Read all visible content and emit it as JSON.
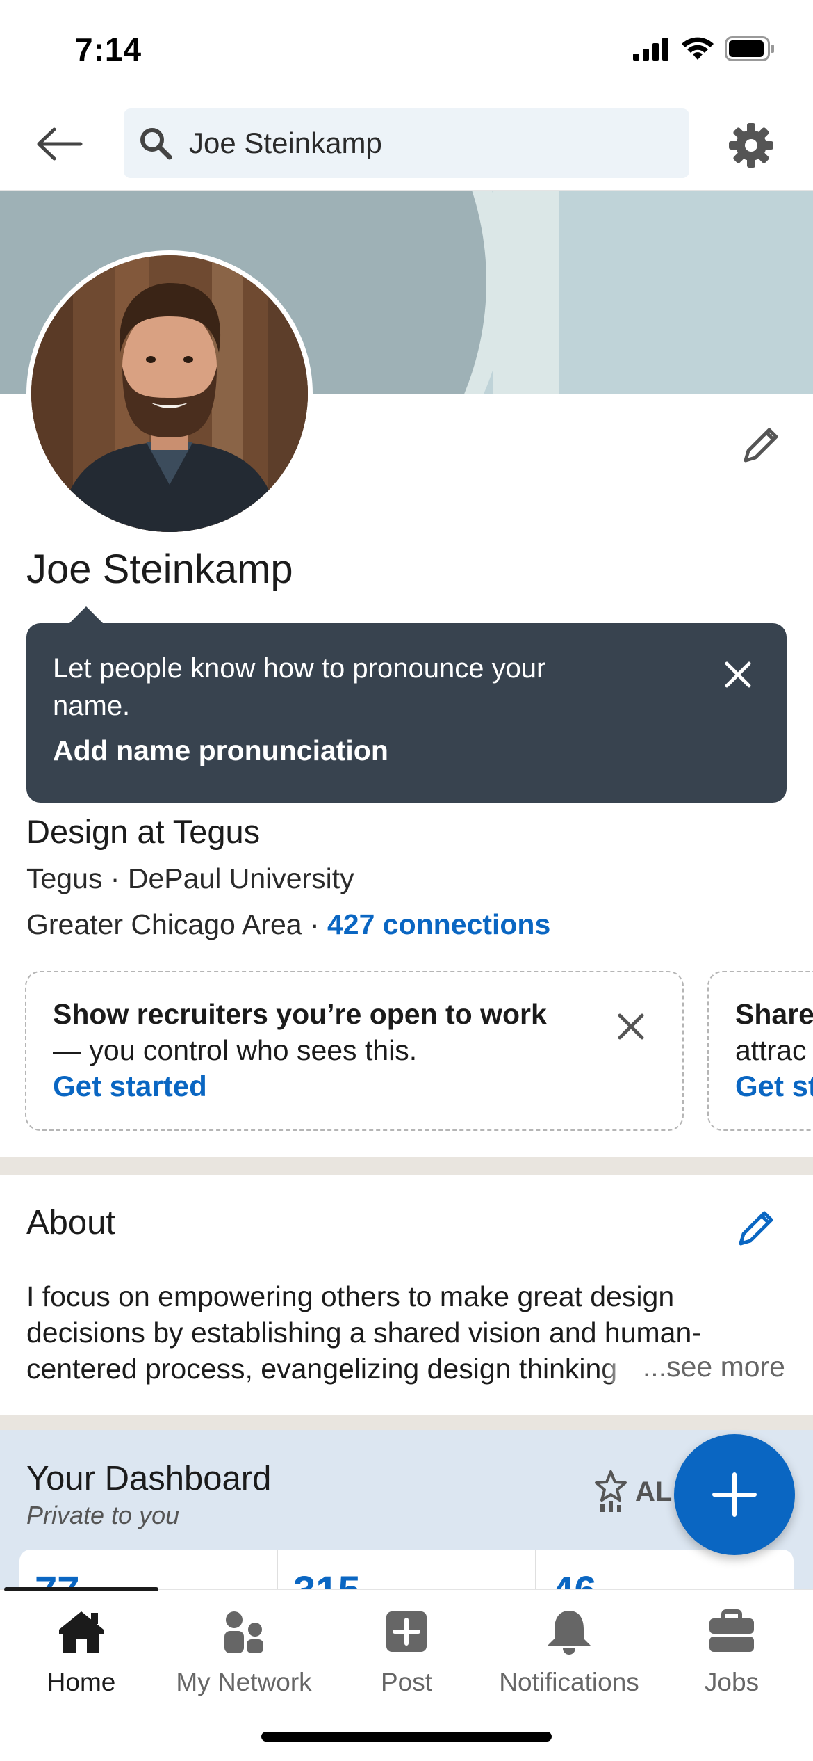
{
  "status_bar": {
    "time": "7:14"
  },
  "search": {
    "query": "Joe Steinkamp"
  },
  "profile": {
    "name": "Joe Steinkamp",
    "headline": "Design at Tegus",
    "subline": "Tegus · DePaul University",
    "location": "Greater Chicago Area · ",
    "connections": "427 connections"
  },
  "tooltip": {
    "text": "Let people know how to pronounce your name.",
    "action": "Add name pronunciation"
  },
  "open_to_work_card": {
    "bold": "Show recruiters you’re open to work",
    "rest": " — you control who sees this.",
    "link": "Get started"
  },
  "second_card": {
    "line1": "Share",
    "line2": "attrac",
    "link": "Get st"
  },
  "about": {
    "title": "About",
    "body": "I focus on empowering others to make great design decisions by establishing a shared vision and human-centered process, evangelizing design thinking",
    "see_more": "...see more"
  },
  "dashboard": {
    "title": "Your Dashboard",
    "subtitle": "Private to you",
    "allstar_label": "AL",
    "stats": [
      "77",
      "315",
      "46"
    ]
  },
  "tabs": [
    {
      "label": "Home",
      "icon": "home-icon"
    },
    {
      "label": "My Network",
      "icon": "network-icon"
    },
    {
      "label": "Post",
      "icon": "post-icon"
    },
    {
      "label": "Notifications",
      "icon": "bell-icon"
    },
    {
      "label": "Jobs",
      "icon": "briefcase-icon"
    }
  ],
  "colors": {
    "accent": "#0a66c2",
    "tooltip": "#38434f",
    "dashboard_bg": "#dce6f1"
  }
}
